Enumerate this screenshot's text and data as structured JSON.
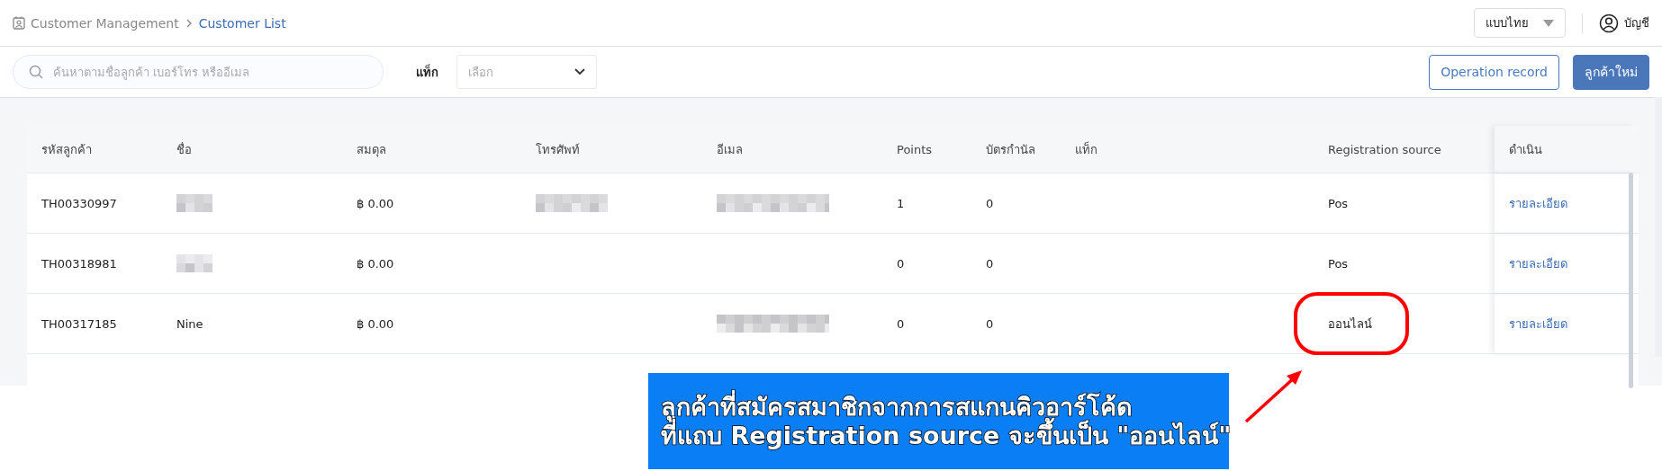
{
  "breadcrumb": [
    {
      "label": "Customer Management",
      "selected": false
    },
    {
      "label": "Customer List",
      "selected": true
    }
  ],
  "language_select": {
    "value": "แบบไทย"
  },
  "account": {
    "label": "บัญชี"
  },
  "search": {
    "placeholder": "ค้นหาตามชื่อลูกค้า เบอร์โทร หรืออีเมล"
  },
  "tag_filter": {
    "label": "แท็ก",
    "placeholder": "เลือก"
  },
  "buttons": [
    {
      "label": "Operation record",
      "kind": "outline"
    },
    {
      "label": "ลูกค้าใหม่",
      "kind": "primary"
    }
  ],
  "table": {
    "columns": [
      {
        "label": "รหัสลูกค้า",
        "kind": "text"
      },
      {
        "label": "ชื่อ",
        "kind": "text"
      },
      {
        "label": "สมดุล",
        "kind": "text"
      },
      {
        "label": "โทรศัพท์",
        "kind": "text"
      },
      {
        "label": "อีเมล",
        "kind": "text"
      },
      {
        "label": "Points",
        "kind": "text"
      },
      {
        "label": "บัตรกำนัล",
        "kind": "text"
      },
      {
        "label": "แท็ก",
        "kind": "text"
      },
      {
        "label": "Registration source",
        "kind": "text"
      },
      {
        "label": "ดำเนิน",
        "kind": "link"
      }
    ],
    "rows": [
      {
        "cells": [
          "TH00330997",
          {
            "kind": "blurred"
          },
          "฿ 0.00",
          {
            "kind": "blurred"
          },
          {
            "kind": "blurred"
          },
          "1",
          "0",
          null,
          "Pos",
          "รายละเอียด"
        ]
      },
      {
        "cells": [
          "TH00318981",
          {
            "kind": "blurred"
          },
          "฿ 0.00",
          null,
          null,
          "0",
          "0",
          null,
          "Pos",
          "รายละเอียด"
        ]
      },
      {
        "cells": [
          "TH00317185",
          "Nine",
          "฿ 0.00",
          null,
          {
            "kind": "blurred"
          },
          "0",
          "0",
          null,
          {
            "text": "ออนไลน์",
            "circled": true
          },
          "รายละเอียด"
        ]
      }
    ]
  },
  "annotation": {
    "lines": [
      "ลูกค้าที่สมัครสมาชิกจากการสแกนคิวอาร์โค้ด",
      "ที่แถบ Registration source จะขึ้นเป็น \"ออนไลน์\""
    ]
  }
}
